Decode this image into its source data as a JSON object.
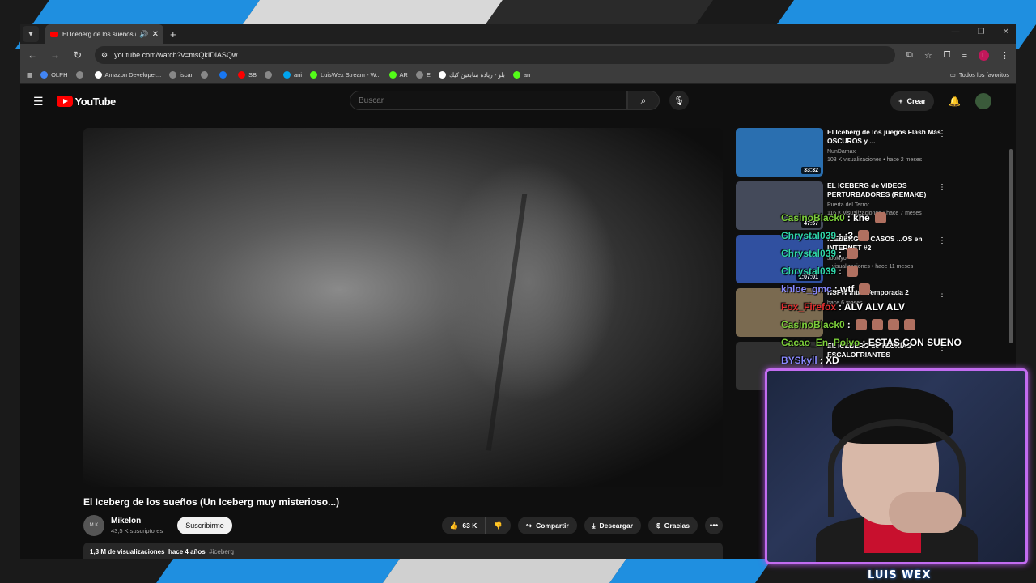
{
  "browser": {
    "tab_title": "El Iceberg de los sueños (U",
    "url": "youtube.com/watch?v=msQkIDiASQw",
    "bookmarks": [
      {
        "label": "OLPH",
        "color": "#4285f4"
      },
      {
        "label": "",
        "color": "#888888"
      },
      {
        "label": "Amazon Developer...",
        "color": "#ffffff"
      },
      {
        "label": "iscar",
        "color": "#888888"
      },
      {
        "label": "",
        "color": "#888888"
      },
      {
        "label": "",
        "color": "#1877f2"
      },
      {
        "label": "SB",
        "color": "#ff0000"
      },
      {
        "label": "",
        "color": "#888888"
      },
      {
        "label": "ani",
        "color": "#00a4ef"
      },
      {
        "label": "LuisWex Stream - W...",
        "color": "#53fc18"
      },
      {
        "label": "AR",
        "color": "#53fc18"
      },
      {
        "label": "E",
        "color": "#888888"
      },
      {
        "label": "بلو - زيادة متابعين كيك",
        "color": "#ffffff"
      },
      {
        "label": "an",
        "color": "#53fc18"
      }
    ],
    "bookmarks_right": "Todos los favoritos",
    "profile_letter": "L"
  },
  "youtube": {
    "logo_text": "YouTube",
    "search_placeholder": "Buscar",
    "create_label": "Crear",
    "video": {
      "title": "El Iceberg de los sueños (Un Iceberg muy misterioso...)",
      "channel": "Mikelon",
      "subscribers": "43,5 K suscriptores",
      "subscribe_label": "Suscribirme",
      "likes": "63 K",
      "share_label": "Compartir",
      "download_label": "Descargar",
      "thanks_label": "Gracias",
      "views": "1,3 M de visualizaciones",
      "age": "hace 4 años",
      "hashtag": "#iceberg"
    },
    "recommendations": [
      {
        "title": "El Iceberg de los juegos Flash Más OSCUROS y ...",
        "channel": "NunDamax",
        "meta": "103 K visualizaciones • hace 2 meses",
        "duration": "33:32",
        "thumb_color": "#2a6fb0"
      },
      {
        "title": "EL ICEBERG de VIDEOS PERTURBADORES (REMAKE)",
        "channel": "Puerta del Terror",
        "meta": "116 K visualizaciones • hace 7 meses",
        "duration": "47:57",
        "thumb_color": "#444a5a"
      },
      {
        "title": "ICEBERG de CASOS ...OS en INTERNET #2",
        "channel": "Jookiyo",
        "meta": "...visualizaciones • hace 11 meses",
        "duration": "1:07:01",
        "thumb_color": "#3050a0"
      },
      {
        "title": "NSFW Intro Temporada 2",
        "channel": "",
        "meta": "hace 6 meses",
        "duration": "",
        "thumb_color": "#7a6a50"
      },
      {
        "title": "EL ICEBERG de TEORÍAS ESCALOFRIANTES",
        "channel": "",
        "meta": "",
        "duration": "0:27",
        "thumb_color": "#303030"
      }
    ]
  },
  "chat": [
    {
      "user": "CasinoBlack0",
      "msg": ": khe",
      "color": "#7ccf3a",
      "emotes": 1
    },
    {
      "user": "Chrystal039",
      "msg": ": :3",
      "color": "#2fd6a8",
      "emotes": 1
    },
    {
      "user": "Chrystal039",
      "msg": ":",
      "color": "#2fd6a8",
      "emotes": 1
    },
    {
      "user": "Chrystal039",
      "msg": ":",
      "color": "#2fd6a8",
      "emotes": 1
    },
    {
      "user": "khloe_gmc",
      "msg": ": wtf",
      "color": "#8a8aff",
      "emotes": 1
    },
    {
      "user": "Fox_Firefox",
      "msg": ": ALV ALV ALV",
      "color": "#e03030",
      "emotes": 0
    },
    {
      "user": "CasinoBlack0",
      "msg": ":",
      "color": "#7ccf3a",
      "emotes": 4
    },
    {
      "user": "Cacao_En_Polvo",
      "msg": ": ESTAS CON SUENO",
      "color": "#7ccf3a",
      "emotes": 0
    },
    {
      "user": "BYSkyll",
      "msg": ": XD",
      "color": "#8a8aff",
      "emotes": 0
    }
  ],
  "streamer_name": "LUIS WEX"
}
